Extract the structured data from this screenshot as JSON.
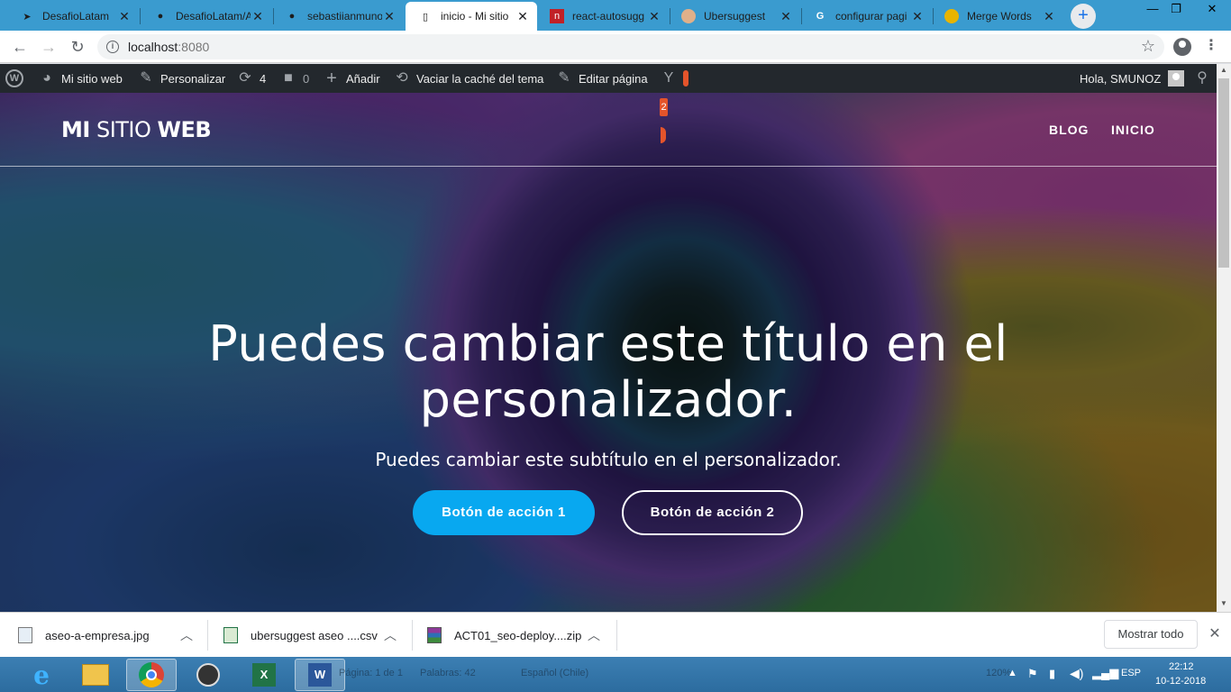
{
  "browser": {
    "tabs": [
      {
        "title": "DesafioLatam",
        "favicon": "desafiolatam-icon",
        "active": false
      },
      {
        "title": "DesafioLatam/A",
        "favicon": "github-icon",
        "active": false
      },
      {
        "title": "sebastiianmuno",
        "favicon": "github-icon",
        "active": false
      },
      {
        "title": "inicio - Mi sitio",
        "favicon": "page-icon",
        "active": true
      },
      {
        "title": "react-autosugg",
        "favicon": "npm-icon",
        "active": false
      },
      {
        "title": "Ubersuggest",
        "favicon": "neil-icon",
        "active": false
      },
      {
        "title": "configurar pagi",
        "favicon": "google-icon",
        "active": false
      },
      {
        "title": "Merge Words",
        "favicon": "merge-icon",
        "active": false
      }
    ],
    "url_host": "localhost",
    "url_port": ":8080"
  },
  "adminbar": {
    "site_name": "Mi sitio web",
    "customize": "Personalizar",
    "updates_count": "4",
    "comments_count": "0",
    "add_new": "Añadir",
    "clear_cache": "Vaciar la caché del tema",
    "edit_page": "Editar página",
    "yoast_count": "2",
    "greeting": "Hola, SMUNOZ"
  },
  "site": {
    "title_part1": "MI",
    "title_part2": "SITIO",
    "title_part3": "WEB",
    "nav": [
      {
        "label": "BLOG"
      },
      {
        "label": "INICIO"
      }
    ],
    "hero_title": "Puedes cambiar este título en el personalizador.",
    "hero_subtitle": "Puedes cambiar este subtítulo en el personalizador.",
    "button1": "Botón de acción 1",
    "button2": "Botón de acción 2",
    "accent_color": "#08a8f0"
  },
  "downloads": {
    "items": [
      {
        "name": "aseo-a-empresa.jpg"
      },
      {
        "name": "ubersuggest aseo ....csv"
      },
      {
        "name": "ACT01_seo-deploy....zip"
      }
    ],
    "show_all": "Mostrar todo"
  },
  "taskbar": {
    "word_status": {
      "page": "Página: 1 de 1",
      "words": "Palabras: 42",
      "language": "Español (Chile)",
      "zoom": "120%"
    },
    "lang": "ESP",
    "time": "22:12",
    "date": "10-12-2018"
  }
}
